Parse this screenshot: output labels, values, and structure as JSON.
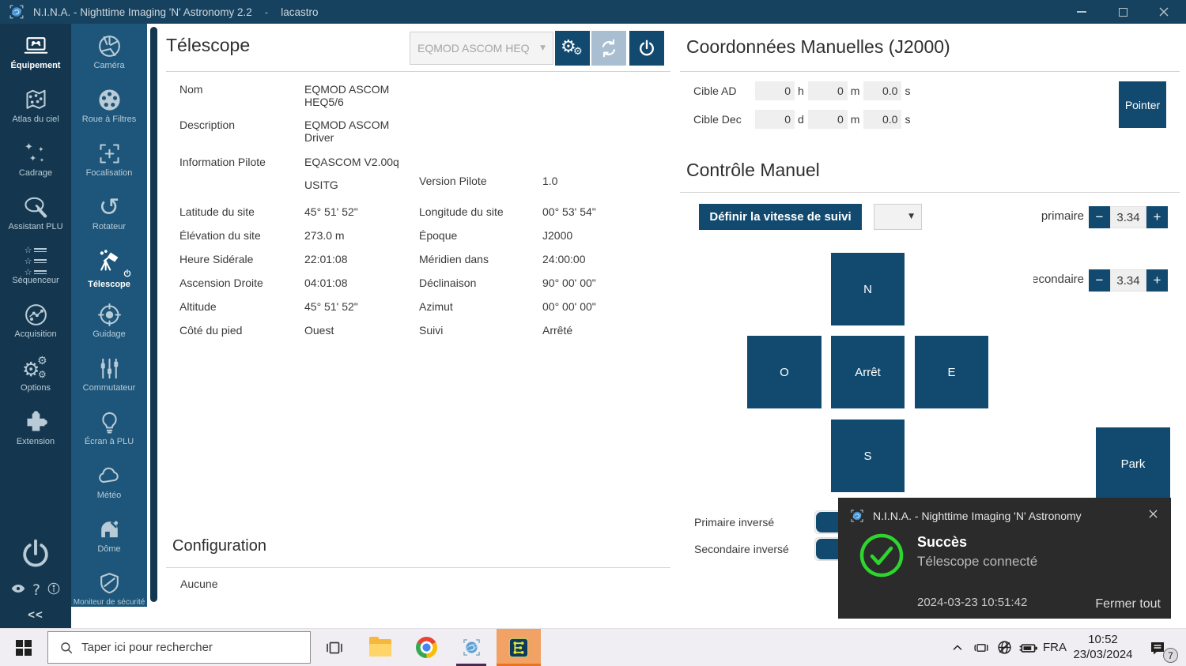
{
  "colors": {
    "titlebar": "#17425f",
    "sidebar_primary": "#14374f",
    "sidebar_secondary": "#1d567a",
    "accent_navy": "#124a6f",
    "success_green": "#2fd52f",
    "toast_bg": "#2b2b2b",
    "taskbar_active_orange": "#f2a265"
  },
  "icons": {
    "gear": "⚙",
    "arrow": "▼",
    "star": "☆",
    "sparkle": "✦",
    "rotate": "↺"
  },
  "window": {
    "title": "N.I.N.A. - Nighttime Imaging 'N' Astronomy 2.2",
    "dash": "-",
    "profile": "lacastro"
  },
  "sidebar": {
    "primary": [
      {
        "label": "Équipement"
      },
      {
        "label": "Atlas du ciel"
      },
      {
        "label": "Cadrage"
      },
      {
        "label": "Assistant PLU"
      },
      {
        "label": "Séquenceur"
      },
      {
        "label": "Acquisition"
      },
      {
        "label": "Options"
      },
      {
        "label": "Extension"
      }
    ],
    "help": "?",
    "collapse": "<<",
    "secondary": [
      {
        "label": "Caméra"
      },
      {
        "label": "Roue à Filtres"
      },
      {
        "label": "Focalisation"
      },
      {
        "label": "Rotateur"
      },
      {
        "label": "Télescope"
      },
      {
        "label": "Guidage"
      },
      {
        "label": "Commutateur"
      },
      {
        "label": "Écran à PLU"
      },
      {
        "label": "Météo"
      },
      {
        "label": "Dôme"
      },
      {
        "label": "Moniteur de sécurité"
      }
    ]
  },
  "telescope": {
    "title": "Télescope",
    "device": "EQMOD ASCOM HEQ",
    "info": {
      "rows": [
        {
          "l": "Nom",
          "v": "EQMOD ASCOM HEQ5/6"
        },
        {
          "l": "Description",
          "v": "EQMOD ASCOM Driver"
        },
        {
          "l": "Information Pilote",
          "v1": "EQASCOM V2.00q",
          "v2": "USITG",
          "l2": "Version Pilote",
          "v3": "1.0"
        },
        {
          "l": "Latitude du site",
          "v": "45° 51' 52\"",
          "l2": "Longitude du site",
          "v2": "00° 53' 54\""
        },
        {
          "l": "Élévation du site",
          "v": "273.0 m",
          "l2": "Époque",
          "v2": "J2000"
        },
        {
          "l": "Heure Sidérale",
          "v": "22:01:08",
          "l2": "Méridien dans",
          "v2": "24:00:00"
        },
        {
          "l": "Ascension Droite",
          "v": "04:01:08",
          "l2": "Déclinaison",
          "v2": "90° 00' 00\""
        },
        {
          "l": "Altitude",
          "v": "45° 51' 52\"",
          "l2": "Azimut",
          "v2": "00° 00' 00\""
        },
        {
          "l": "Côté du pied",
          "v": "Ouest",
          "l2": "Suivi",
          "v2": "Arrêté"
        }
      ]
    },
    "configuration": {
      "title": "Configuration",
      "empty": "Aucune"
    }
  },
  "coords": {
    "title": "Coordonnées Manuelles (J2000)",
    "ra_label": "Cible AD",
    "dec_label": "Cible Dec",
    "ra": {
      "h": "0",
      "m": "0",
      "s": "0.0"
    },
    "dec": {
      "d": "0",
      "m": "0",
      "s": "0.0"
    },
    "units": {
      "h": "h",
      "m": "m",
      "s": "s",
      "d": "d"
    },
    "slew": "Pointer"
  },
  "control": {
    "title": "Contrôle Manuel",
    "tracking_button": "Définir la vitesse de suivi",
    "primary_label": "primaire",
    "secondary_label": "secondaire",
    "primary_rate": "3.34",
    "secondary_rate": "3.34",
    "minus": "−",
    "plus": "+",
    "pad": {
      "n": "N",
      "w": "O",
      "stop": "Arrêt",
      "e": "E",
      "s": "S"
    },
    "park": "Park",
    "primary_reversed": "Primaire inversé",
    "secondary_reversed": "Secondaire inversé"
  },
  "toast": {
    "app": "N.I.N.A. - Nighttime Imaging 'N' Astronomy",
    "status": "Succès",
    "message": "Télescope connecté",
    "time": "2024-03-23 10:51:42",
    "close_all": "Fermer tout"
  },
  "taskbar": {
    "search_placeholder": "Taper ici pour rechercher",
    "language": "FRA",
    "time": "10:52",
    "date": "23/03/2024",
    "badge": "7"
  }
}
